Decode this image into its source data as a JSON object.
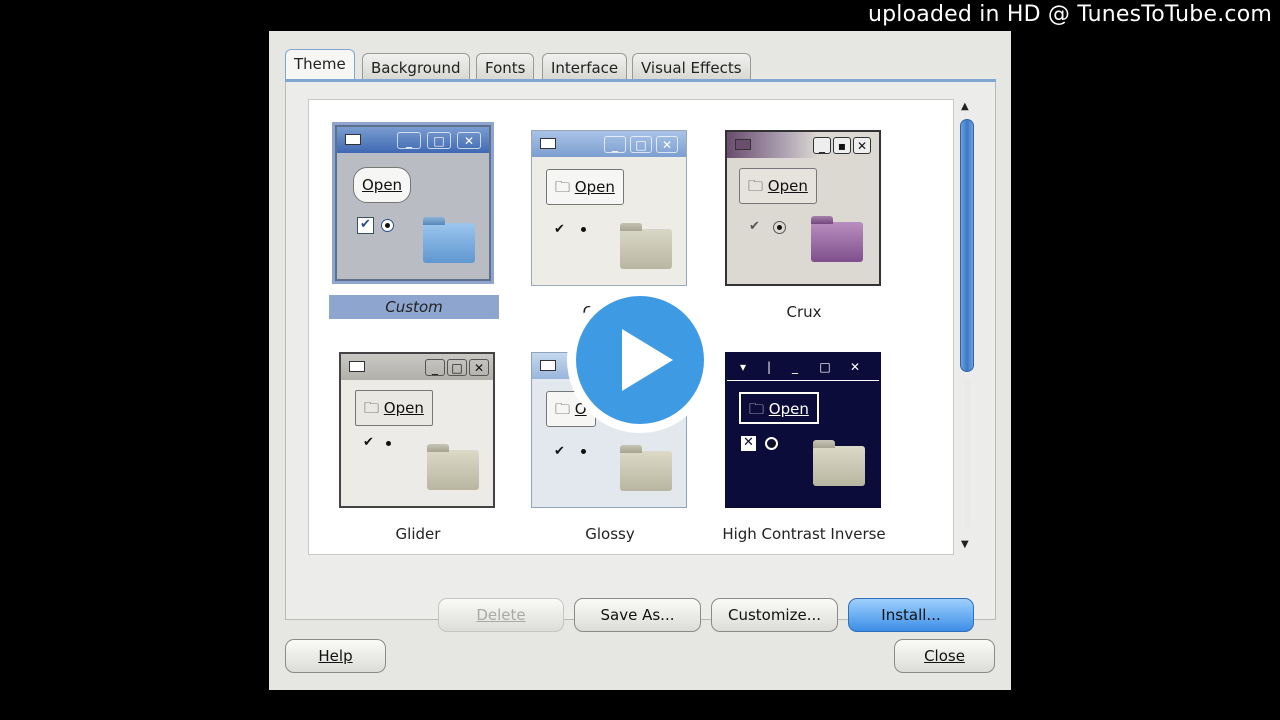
{
  "watermark": "uploaded in HD @ TunesToTube.com",
  "tabs": [
    "Theme",
    "Background",
    "Fonts",
    "Interface",
    "Visual Effects"
  ],
  "active_tab": "Theme",
  "themes": [
    {
      "name": "Custom",
      "selected": true,
      "open_label": "Open"
    },
    {
      "name": "Cl",
      "selected": false,
      "open_label": "Open"
    },
    {
      "name": "Crux",
      "selected": false,
      "open_label": "Open"
    },
    {
      "name": "Glider",
      "selected": false,
      "open_label": "Open"
    },
    {
      "name": "Glossy",
      "selected": false,
      "open_label": "O"
    },
    {
      "name": "High Contrast Inverse",
      "selected": false,
      "open_label": "Open"
    }
  ],
  "panel_buttons": {
    "delete": "Delete",
    "save_as": "Save As...",
    "customize": "Customize...",
    "install": "Install..."
  },
  "footer_buttons": {
    "help": "Help",
    "close": "Close"
  },
  "colors": {
    "accent": "#3c8ee6",
    "selection": "#8ea6cf",
    "play_button": "#3e9be3"
  },
  "icons": [
    "play-icon",
    "folder-icon",
    "checkbox-icon",
    "radio-icon",
    "window-icon",
    "minimize-icon",
    "maximize-icon",
    "close-icon",
    "scroll-up-icon",
    "scroll-down-icon"
  ]
}
